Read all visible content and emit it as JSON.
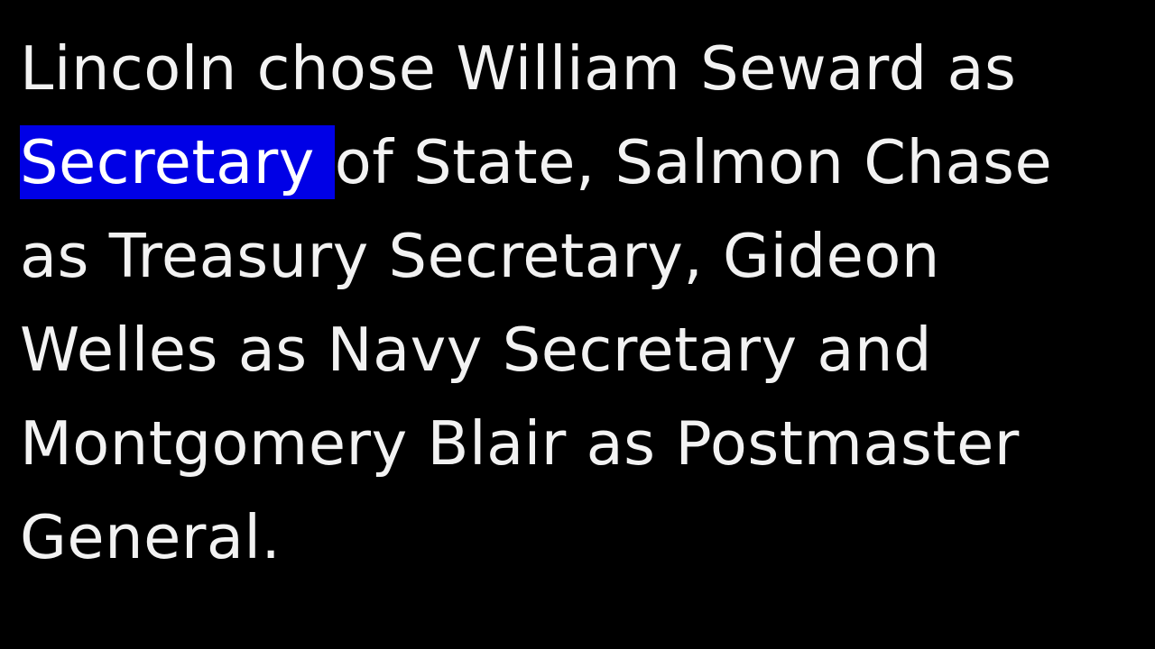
{
  "colors": {
    "background": "#000000",
    "text": "#f2f2f2",
    "highlight": "#0000e6"
  },
  "caption": {
    "line1": "Lincoln chose William Seward as",
    "line2_highlighted": "Secretary ",
    "line2_rest": "of State, Salmon Chase",
    "line3": "as Treasury Secretary, Gideon",
    "line4": "Welles as Navy Secretary and",
    "line5": "Montgomery Blair as Postmaster",
    "line6": "General."
  }
}
